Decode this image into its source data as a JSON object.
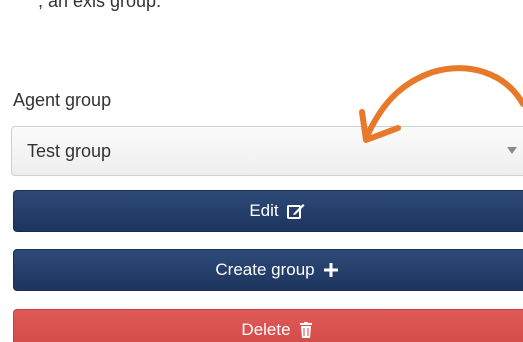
{
  "top_text": ", an exis group.",
  "agent_group": {
    "label": "Agent group",
    "selected": "Test group"
  },
  "buttons": {
    "edit": "Edit",
    "create": "Create group",
    "delete": "Delete"
  },
  "colors": {
    "navy": "#1d355f",
    "red": "#d24a47",
    "arrow": "#e8792a"
  },
  "icons": {
    "edit": "edit-icon",
    "create": "plus-icon",
    "delete": "trash-icon",
    "select": "chevron-down-icon",
    "annotation": "curved-arrow-icon"
  }
}
